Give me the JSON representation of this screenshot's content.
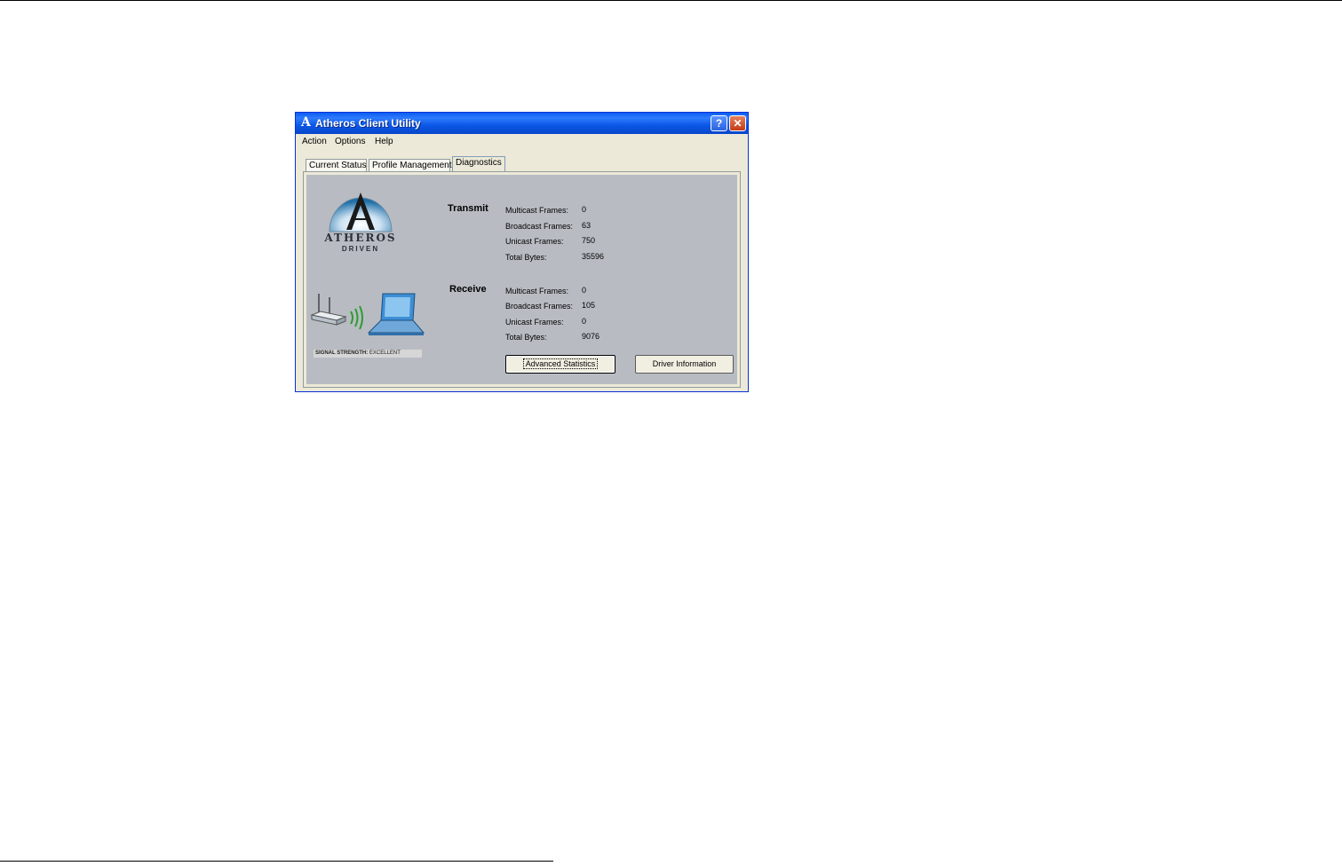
{
  "window": {
    "title": "Atheros Client Utility",
    "title_logo": "A",
    "help_button": "?",
    "close_button": "✕"
  },
  "menu": [
    "Action",
    "Options",
    "Help"
  ],
  "tabs": [
    {
      "label": "Current Status",
      "active": false
    },
    {
      "label": "Profile Management",
      "active": false
    },
    {
      "label": "Diagnostics",
      "active": true
    }
  ],
  "logo": {
    "word": "ATHEROS",
    "sub": "DRIVEN"
  },
  "signal": {
    "label": "SIGNAL STRENGTH:",
    "value": "EXCELLENT"
  },
  "transmit": {
    "title": "Transmit",
    "rows": [
      {
        "label": "Multicast Frames:",
        "value": "0"
      },
      {
        "label": "Broadcast Frames:",
        "value": "63"
      },
      {
        "label": "Unicast Frames:",
        "value": "750"
      },
      {
        "label": "Total Bytes:",
        "value": "35596"
      }
    ]
  },
  "receive": {
    "title": "Receive",
    "rows": [
      {
        "label": "Multicast Frames:",
        "value": "0"
      },
      {
        "label": "Broadcast Frames:",
        "value": "105"
      },
      {
        "label": "Unicast Frames:",
        "value": "0"
      },
      {
        "label": "Total Bytes:",
        "value": "9076"
      }
    ]
  },
  "buttons": {
    "advanced": "Advanced Statistics",
    "driver": "Driver Information"
  },
  "colors": {
    "titlebar": "#0a5cf0",
    "panel_bg": "#b8bcc2",
    "dialog_bg": "#ece9d8"
  }
}
